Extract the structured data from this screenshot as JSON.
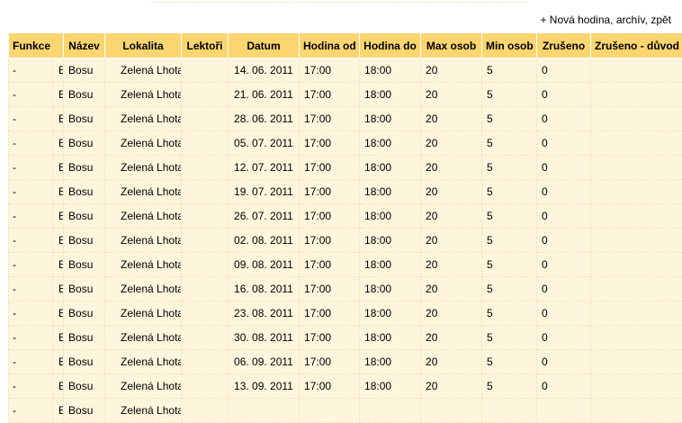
{
  "header": {
    "new_link": "+ Nová hodina",
    "sep1": ", ",
    "archive_link": "archív",
    "sep2": ", ",
    "back_link": "zpět"
  },
  "table": {
    "columns": [
      "Funkce",
      "Název",
      "Lokalita",
      "Lektoři",
      "Datum",
      "Hodina od",
      "Hodina do",
      "Max osob",
      "Min osob",
      "Zrušeno",
      "Zrušeno - důvod"
    ],
    "rows": [
      {
        "func": "-",
        "edit": "E",
        "nazev": "Bosu",
        "lokalita": "Zelená Lhota",
        "lektori": "",
        "datum": "14. 06. 2011",
        "od": "17:00",
        "do": "18:00",
        "max": "20",
        "min": "5",
        "zruseno": "0",
        "duvod": ""
      },
      {
        "func": "-",
        "edit": "E",
        "nazev": "Bosu",
        "lokalita": "Zelená Lhota",
        "lektori": "",
        "datum": "21. 06. 2011",
        "od": "17:00",
        "do": "18:00",
        "max": "20",
        "min": "5",
        "zruseno": "0",
        "duvod": ""
      },
      {
        "func": "-",
        "edit": "E",
        "nazev": "Bosu",
        "lokalita": "Zelená Lhota",
        "lektori": "",
        "datum": "28. 06. 2011",
        "od": "17:00",
        "do": "18:00",
        "max": "20",
        "min": "5",
        "zruseno": "0",
        "duvod": ""
      },
      {
        "func": "-",
        "edit": "E",
        "nazev": "Bosu",
        "lokalita": "Zelená Lhota",
        "lektori": "",
        "datum": "05. 07. 2011",
        "od": "17:00",
        "do": "18:00",
        "max": "20",
        "min": "5",
        "zruseno": "0",
        "duvod": ""
      },
      {
        "func": "-",
        "edit": "E",
        "nazev": "Bosu",
        "lokalita": "Zelená Lhota",
        "lektori": "",
        "datum": "12. 07. 2011",
        "od": "17:00",
        "do": "18:00",
        "max": "20",
        "min": "5",
        "zruseno": "0",
        "duvod": ""
      },
      {
        "func": "-",
        "edit": "E",
        "nazev": "Bosu",
        "lokalita": "Zelená Lhota",
        "lektori": "",
        "datum": "19. 07. 2011",
        "od": "17:00",
        "do": "18:00",
        "max": "20",
        "min": "5",
        "zruseno": "0",
        "duvod": ""
      },
      {
        "func": "-",
        "edit": "E",
        "nazev": "Bosu",
        "lokalita": "Zelená Lhota",
        "lektori": "",
        "datum": "26. 07. 2011",
        "od": "17:00",
        "do": "18:00",
        "max": "20",
        "min": "5",
        "zruseno": "0",
        "duvod": ""
      },
      {
        "func": "-",
        "edit": "E",
        "nazev": "Bosu",
        "lokalita": "Zelená Lhota",
        "lektori": "",
        "datum": "02. 08. 2011",
        "od": "17:00",
        "do": "18:00",
        "max": "20",
        "min": "5",
        "zruseno": "0",
        "duvod": ""
      },
      {
        "func": "-",
        "edit": "E",
        "nazev": "Bosu",
        "lokalita": "Zelená Lhota",
        "lektori": "",
        "datum": "09. 08. 2011",
        "od": "17:00",
        "do": "18:00",
        "max": "20",
        "min": "5",
        "zruseno": "0",
        "duvod": ""
      },
      {
        "func": "-",
        "edit": "E",
        "nazev": "Bosu",
        "lokalita": "Zelená Lhota",
        "lektori": "",
        "datum": "16. 08. 2011",
        "od": "17:00",
        "do": "18:00",
        "max": "20",
        "min": "5",
        "zruseno": "0",
        "duvod": ""
      },
      {
        "func": "-",
        "edit": "E",
        "nazev": "Bosu",
        "lokalita": "Zelená Lhota",
        "lektori": "",
        "datum": "23. 08. 2011",
        "od": "17:00",
        "do": "18:00",
        "max": "20",
        "min": "5",
        "zruseno": "0",
        "duvod": ""
      },
      {
        "func": "-",
        "edit": "E",
        "nazev": "Bosu",
        "lokalita": "Zelená Lhota",
        "lektori": "",
        "datum": "30. 08. 2011",
        "od": "17:00",
        "do": "18:00",
        "max": "20",
        "min": "5",
        "zruseno": "0",
        "duvod": ""
      },
      {
        "func": "-",
        "edit": "E",
        "nazev": "Bosu",
        "lokalita": "Zelená Lhota",
        "lektori": "",
        "datum": "06. 09. 2011",
        "od": "17:00",
        "do": "18:00",
        "max": "20",
        "min": "5",
        "zruseno": "0",
        "duvod": ""
      },
      {
        "func": "-",
        "edit": "E",
        "nazev": "Bosu",
        "lokalita": "Zelená Lhota",
        "lektori": "",
        "datum": "13. 09. 2011",
        "od": "17:00",
        "do": "18:00",
        "max": "20",
        "min": "5",
        "zruseno": "0",
        "duvod": ""
      },
      {
        "func": "-",
        "edit": "E",
        "nazev": "Bosu",
        "lokalita": "Zelená Lhota",
        "lektori": "",
        "datum": "",
        "od": "",
        "do": "",
        "max": "",
        "min": "",
        "zruseno": "",
        "duvod": ""
      }
    ]
  },
  "colors": {
    "header_bg": "#fbd56f",
    "row_bg": "#fdf5dc",
    "border": "#f3d98f"
  }
}
